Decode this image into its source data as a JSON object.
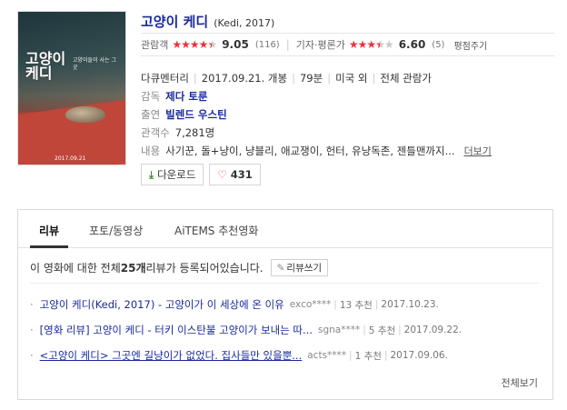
{
  "poster": {
    "title_line1": "고양이",
    "title_line2": "케디",
    "tagline": "고양이들이 사는 그곳",
    "date": "2017.09.21"
  },
  "movie": {
    "title": "고양이 케디",
    "title_en": "(Kedi, 2017)",
    "audience_label": "관람객",
    "audience_stars": 4.5,
    "audience_score": "9.05",
    "audience_count": "(116)",
    "critic_label": "기자·평론가",
    "critic_stars": 3.5,
    "critic_score": "6.60",
    "critic_count": "(5)",
    "evaluate_label": "평점주기",
    "genre": "다큐멘터리",
    "release": "2017.09.21. 개봉",
    "runtime": "79분",
    "country": "미국 외",
    "rating": "전체 관람가",
    "director_label": "감독",
    "director": "제다 토룬",
    "cast_label": "출연",
    "cast": "빌렌드 우스틴",
    "viewers_label": "관객수",
    "viewers": "7,281명",
    "content_label": "내용",
    "content": "사기꾼, 돌+냥이, 냥블리, 애교쟁이, 헌터, 유냥독존, 젠틀맨까지...",
    "more_label": "더보기",
    "download_label": "다운로드",
    "like_count": "431"
  },
  "reviews": {
    "tabs": [
      "리뷰",
      "포토/동영상",
      "AiTEMS 추천영화"
    ],
    "summary_prefix": "이 영화에 대한 전체 ",
    "summary_count": "25개",
    "summary_suffix": " 리뷰가 등록되어있습니다.",
    "write_label": "리뷰쓰기",
    "items": [
      {
        "title": "고양이 케디(Kedi, 2017) - 고양이가 이 세상에 온 이유",
        "author": "exco****",
        "recommend": "13 추천",
        "date": "2017.10.23."
      },
      {
        "title": "[영화 리뷰] 고양이 케디 - 터키 이스탄불 고양이가 보내는 따...",
        "author": "sgna****",
        "recommend": "5 추천",
        "date": "2017.09.22."
      },
      {
        "title": "<고양이 케디> 그곳엔 길냥이가 없었다. 집사들만 있을뿐...",
        "author": "acts****",
        "recommend": "1 추천",
        "date": "2017.09.06."
      }
    ],
    "view_all": "전체보기"
  },
  "colors": {
    "link_blue": "#1a2a9c",
    "star_red": "#e8333d",
    "download_green": "#3b8c2a"
  }
}
